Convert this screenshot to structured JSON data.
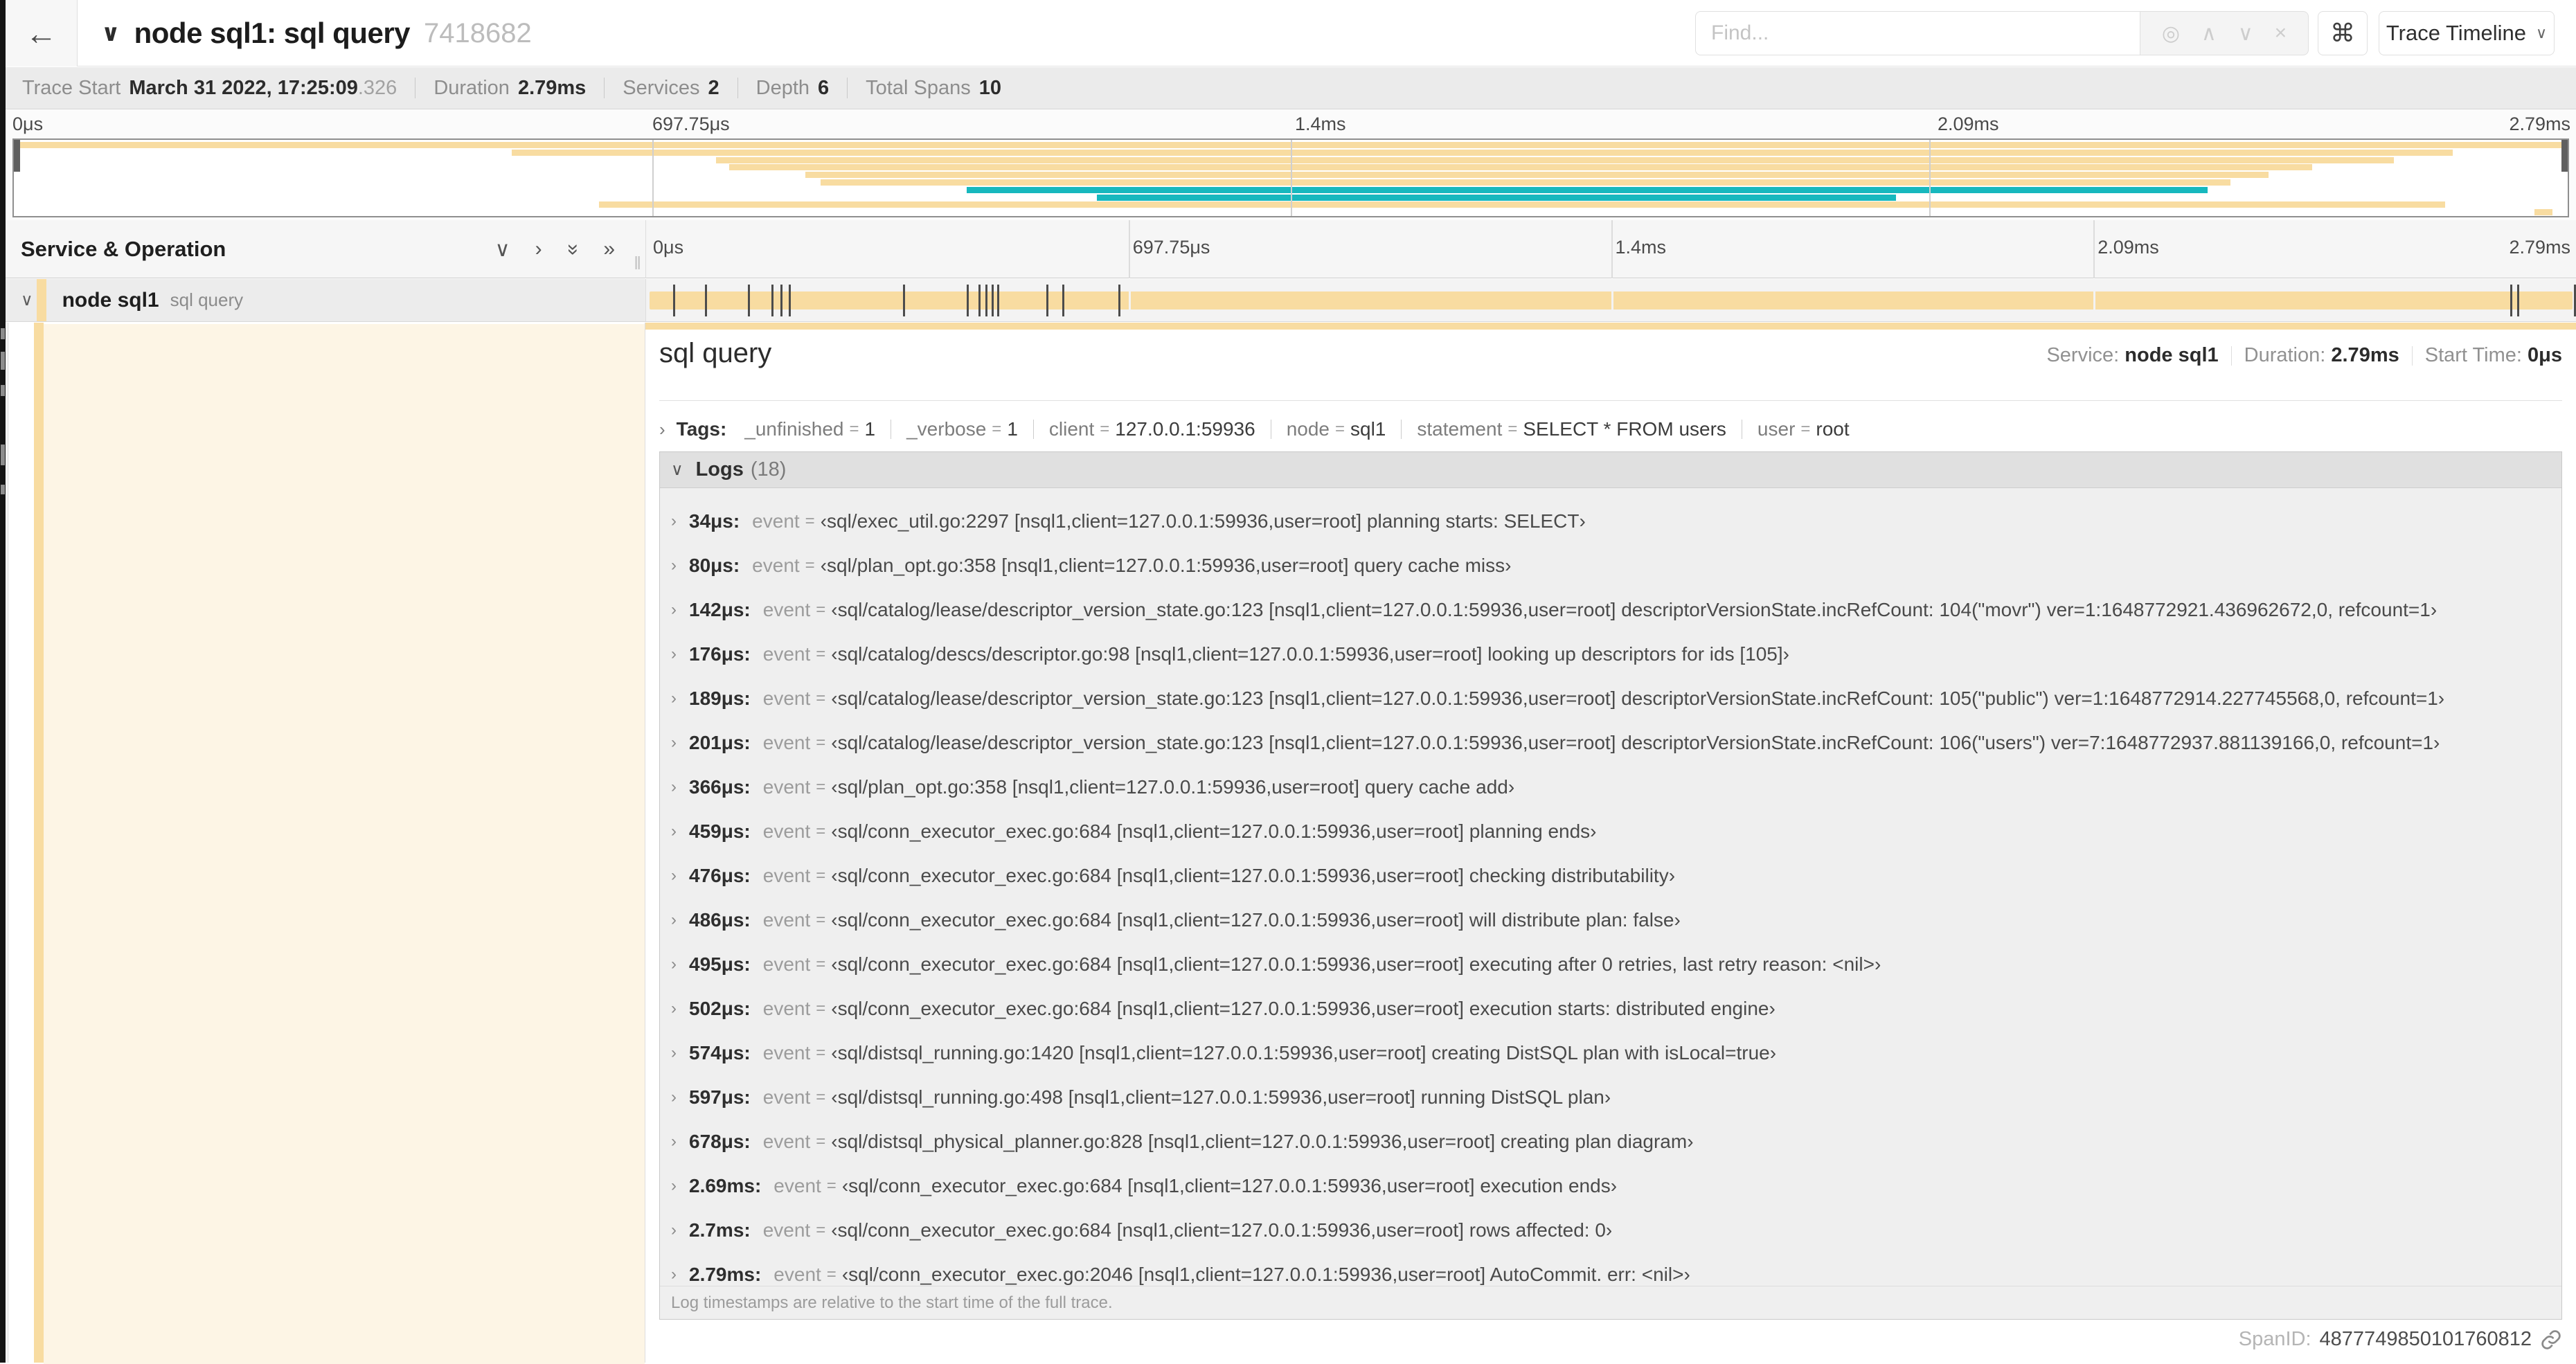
{
  "icons": {
    "back": "←",
    "caret_down": "∨",
    "caret_right": "›",
    "expand_all": "»",
    "locate": "◎",
    "prev": "∧",
    "next": "∨",
    "clear": "×",
    "keyboard": "⌘",
    "resizer": "‖",
    "link": "link-icon"
  },
  "colors": {
    "tan": "#F8DCA1",
    "teal": "#17B8BE",
    "cream": "rgba(248,220,161,0.28)"
  },
  "header": {
    "title": "node sql1: sql query",
    "trace_id": "7418682",
    "find_placeholder": "Find...",
    "view_select_label": "Trace Timeline"
  },
  "trace_info": {
    "items": [
      {
        "label": "Trace Start",
        "value": "March 31 2022, 17:25:09",
        "extra": ".326"
      },
      {
        "label": "Duration",
        "value": "2.79ms",
        "extra": ""
      },
      {
        "label": "Services",
        "value": "2",
        "extra": ""
      },
      {
        "label": "Depth",
        "value": "6",
        "extra": ""
      },
      {
        "label": "Total Spans",
        "value": "10",
        "extra": ""
      }
    ]
  },
  "timeline": {
    "ticks": [
      {
        "label": "0μs",
        "pct": 0
      },
      {
        "label": "697.75μs",
        "pct": 25
      },
      {
        "label": "1.4ms",
        "pct": 50
      },
      {
        "label": "2.09ms",
        "pct": 75
      },
      {
        "label": "2.79ms",
        "pct": 100
      }
    ]
  },
  "minimap": {
    "spans": [
      {
        "start": 0,
        "end": 100,
        "color": "tan"
      },
      {
        "start": 19.5,
        "end": 95.5,
        "color": "tan"
      },
      {
        "start": 27.5,
        "end": 93.2,
        "color": "tan"
      },
      {
        "start": 28.0,
        "end": 90.0,
        "color": "tan"
      },
      {
        "start": 31.0,
        "end": 88.3,
        "color": "tan"
      },
      {
        "start": 31.6,
        "end": 86.8,
        "color": "tan"
      },
      {
        "start": 37.3,
        "end": 85.9,
        "color": "teal"
      },
      {
        "start": 42.4,
        "end": 73.7,
        "color": "teal"
      },
      {
        "start": 22.9,
        "end": 95.2,
        "color": "tan"
      },
      {
        "start": 98.7,
        "end": 99.4,
        "color": "tan"
      }
    ]
  },
  "left_panel": {
    "header": "Service & Operation",
    "row": {
      "service": "node sql1",
      "operation": "sql query"
    }
  },
  "span_row": {
    "tick_pcts": [
      1.22,
      2.87,
      5.09,
      6.31,
      6.77,
      7.2,
      13.12,
      16.45,
      17.06,
      17.42,
      17.74,
      18.0,
      20.57,
      21.4,
      24.3,
      96.4,
      96.77,
      99.7
    ]
  },
  "detail": {
    "title": "sql query",
    "meta": [
      {
        "label": "Service:",
        "value": "node sql1"
      },
      {
        "label": "Duration:",
        "value": "2.79ms"
      },
      {
        "label": "Start Time:",
        "value": "0μs"
      }
    ],
    "tags_label": "Tags:",
    "tags": [
      {
        "key": "_unfinished",
        "value": "1"
      },
      {
        "key": "_verbose",
        "value": "1"
      },
      {
        "key": "client",
        "value": "127.0.0.1:59936"
      },
      {
        "key": "node",
        "value": "sql1"
      },
      {
        "key": "statement",
        "value": "SELECT * FROM users"
      },
      {
        "key": "user",
        "value": "root"
      }
    ],
    "logs_label": "Logs",
    "logs_count": "(18)",
    "logs_field": "event",
    "logs": [
      {
        "time": "34μs:",
        "value": "‹sql/exec_util.go:2297 [nsql1,client=127.0.0.1:59936,user=root] planning starts: SELECT›"
      },
      {
        "time": "80μs:",
        "value": "‹sql/plan_opt.go:358 [nsql1,client=127.0.0.1:59936,user=root] query cache miss›"
      },
      {
        "time": "142μs:",
        "value": "‹sql/catalog/lease/descriptor_version_state.go:123 [nsql1,client=127.0.0.1:59936,user=root] descriptorVersionState.incRefCount: 104(\"movr\") ver=1:1648772921.436962672,0, refcount=1›"
      },
      {
        "time": "176μs:",
        "value": "‹sql/catalog/descs/descriptor.go:98 [nsql1,client=127.0.0.1:59936,user=root] looking up descriptors for ids [105]›"
      },
      {
        "time": "189μs:",
        "value": "‹sql/catalog/lease/descriptor_version_state.go:123 [nsql1,client=127.0.0.1:59936,user=root] descriptorVersionState.incRefCount: 105(\"public\") ver=1:1648772914.227745568,0, refcount=1›"
      },
      {
        "time": "201μs:",
        "value": "‹sql/catalog/lease/descriptor_version_state.go:123 [nsql1,client=127.0.0.1:59936,user=root] descriptorVersionState.incRefCount: 106(\"users\") ver=7:1648772937.881139166,0, refcount=1›"
      },
      {
        "time": "366μs:",
        "value": "‹sql/plan_opt.go:358 [nsql1,client=127.0.0.1:59936,user=root] query cache add›"
      },
      {
        "time": "459μs:",
        "value": "‹sql/conn_executor_exec.go:684 [nsql1,client=127.0.0.1:59936,user=root] planning ends›"
      },
      {
        "time": "476μs:",
        "value": "‹sql/conn_executor_exec.go:684 [nsql1,client=127.0.0.1:59936,user=root] checking distributability›"
      },
      {
        "time": "486μs:",
        "value": "‹sql/conn_executor_exec.go:684 [nsql1,client=127.0.0.1:59936,user=root] will distribute plan: false›"
      },
      {
        "time": "495μs:",
        "value": "‹sql/conn_executor_exec.go:684 [nsql1,client=127.0.0.1:59936,user=root] executing after 0 retries, last retry reason: <nil>›"
      },
      {
        "time": "502μs:",
        "value": "‹sql/conn_executor_exec.go:684 [nsql1,client=127.0.0.1:59936,user=root] execution starts: distributed engine›"
      },
      {
        "time": "574μs:",
        "value": "‹sql/distsql_running.go:1420 [nsql1,client=127.0.0.1:59936,user=root] creating DistSQL plan with isLocal=true›"
      },
      {
        "time": "597μs:",
        "value": "‹sql/distsql_running.go:498 [nsql1,client=127.0.0.1:59936,user=root] running DistSQL plan›"
      },
      {
        "time": "678μs:",
        "value": "‹sql/distsql_physical_planner.go:828 [nsql1,client=127.0.0.1:59936,user=root] creating plan diagram›"
      },
      {
        "time": "2.69ms:",
        "value": "‹sql/conn_executor_exec.go:684 [nsql1,client=127.0.0.1:59936,user=root] execution ends›"
      },
      {
        "time": "2.7ms:",
        "value": "‹sql/conn_executor_exec.go:684 [nsql1,client=127.0.0.1:59936,user=root] rows affected: 0›"
      },
      {
        "time": "2.79ms:",
        "value": "‹sql/conn_executor_exec.go:2046 [nsql1,client=127.0.0.1:59936,user=root] AutoCommit. err: <nil>›"
      }
    ],
    "logs_footer": "Log timestamps are relative to the start time of the full trace.",
    "span_id_label": "SpanID:",
    "span_id": "4877749850101760812"
  }
}
